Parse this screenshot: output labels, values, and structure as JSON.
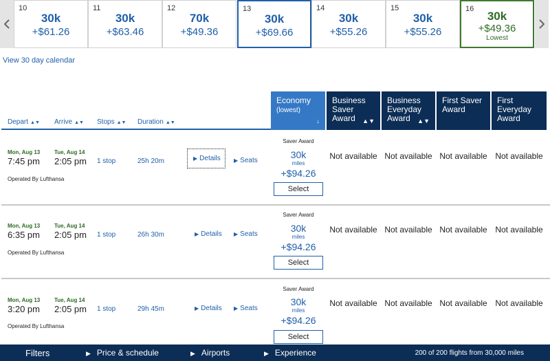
{
  "date_strip": {
    "days": [
      {
        "day": "10",
        "miles": "30k",
        "fee": "+$61.26",
        "tag": ""
      },
      {
        "day": "11",
        "miles": "30k",
        "fee": "+$63.46",
        "tag": ""
      },
      {
        "day": "12",
        "miles": "70k",
        "fee": "+$49.36",
        "tag": ""
      },
      {
        "day": "13",
        "miles": "30k",
        "fee": "+$69.66",
        "tag": ""
      },
      {
        "day": "14",
        "miles": "30k",
        "fee": "+$55.26",
        "tag": ""
      },
      {
        "day": "15",
        "miles": "30k",
        "fee": "+$55.26",
        "tag": ""
      },
      {
        "day": "16",
        "miles": "30k",
        "fee": "+$49.36",
        "tag": "Lowest"
      }
    ],
    "selected_index": 3,
    "prev_icon": "chevron-left-icon",
    "next_icon": "chevron-right-icon"
  },
  "calendar_link": "View 30 day calendar",
  "columns": {
    "depart": "Depart",
    "arrive": "Arrive",
    "stops": "Stops",
    "duration": "Duration",
    "sort_glyph": "▲▼"
  },
  "fare_columns": [
    {
      "title": "Economy",
      "subtitle": "(lowest)",
      "sort": "↓"
    },
    {
      "title": "Business Saver Award",
      "subtitle": "",
      "sort": "▲▼"
    },
    {
      "title": "Business Everyday Award",
      "subtitle": "",
      "sort": "▲▼"
    },
    {
      "title": "First Saver Award",
      "subtitle": "",
      "sort": ""
    },
    {
      "title": "First Everyday Award",
      "subtitle": "",
      "sort": ""
    }
  ],
  "flights": [
    {
      "depart_date": "Mon, Aug 13",
      "depart_time": "7:45 pm",
      "arrive_date": "Tue, Aug 14",
      "arrive_time": "2:05 pm",
      "stops": "1 stop",
      "duration": "25h 20m",
      "details": "Details",
      "seats": "Seats",
      "operated_by": "Operated By Lufthansa",
      "economy": {
        "label": "Saver Award",
        "miles": "30k",
        "unit": "miles",
        "fee": "+$94.26",
        "button": "Select"
      },
      "others": [
        "Not available",
        "Not available",
        "Not available",
        "Not available"
      ]
    },
    {
      "depart_date": "Mon, Aug 13",
      "depart_time": "6:35 pm",
      "arrive_date": "Tue, Aug 14",
      "arrive_time": "2:05 pm",
      "stops": "1 stop",
      "duration": "26h 30m",
      "details": "Details",
      "seats": "Seats",
      "operated_by": "Operated By Lufthansa",
      "economy": {
        "label": "Saver Award",
        "miles": "30k",
        "unit": "miles",
        "fee": "+$94.26",
        "button": "Select"
      },
      "others": [
        "Not available",
        "Not available",
        "Not available",
        "Not available"
      ]
    },
    {
      "depart_date": "Mon, Aug 13",
      "depart_time": "3:20 pm",
      "arrive_date": "Tue, Aug 14",
      "arrive_time": "2:05 pm",
      "stops": "1 stop",
      "duration": "29h 45m",
      "details": "Details",
      "seats": "Seats",
      "operated_by": "Operated By Lufthansa",
      "economy": {
        "label": "Saver Award",
        "miles": "30k",
        "unit": "miles",
        "fee": "+$94.26",
        "button": "Select"
      },
      "others": [
        "Not available",
        "Not available",
        "Not available",
        "Not available"
      ]
    }
  ],
  "footer": {
    "filters": "Filters",
    "links": [
      "Price & schedule",
      "Airports",
      "Experience"
    ],
    "count": "200 of 200 flights from 30,000 miles"
  },
  "colors": {
    "brand_blue": "#1f5fa8",
    "header_navy": "#0c2d55",
    "economy_header": "#3578c5",
    "lowest_green": "#2e6b26"
  }
}
